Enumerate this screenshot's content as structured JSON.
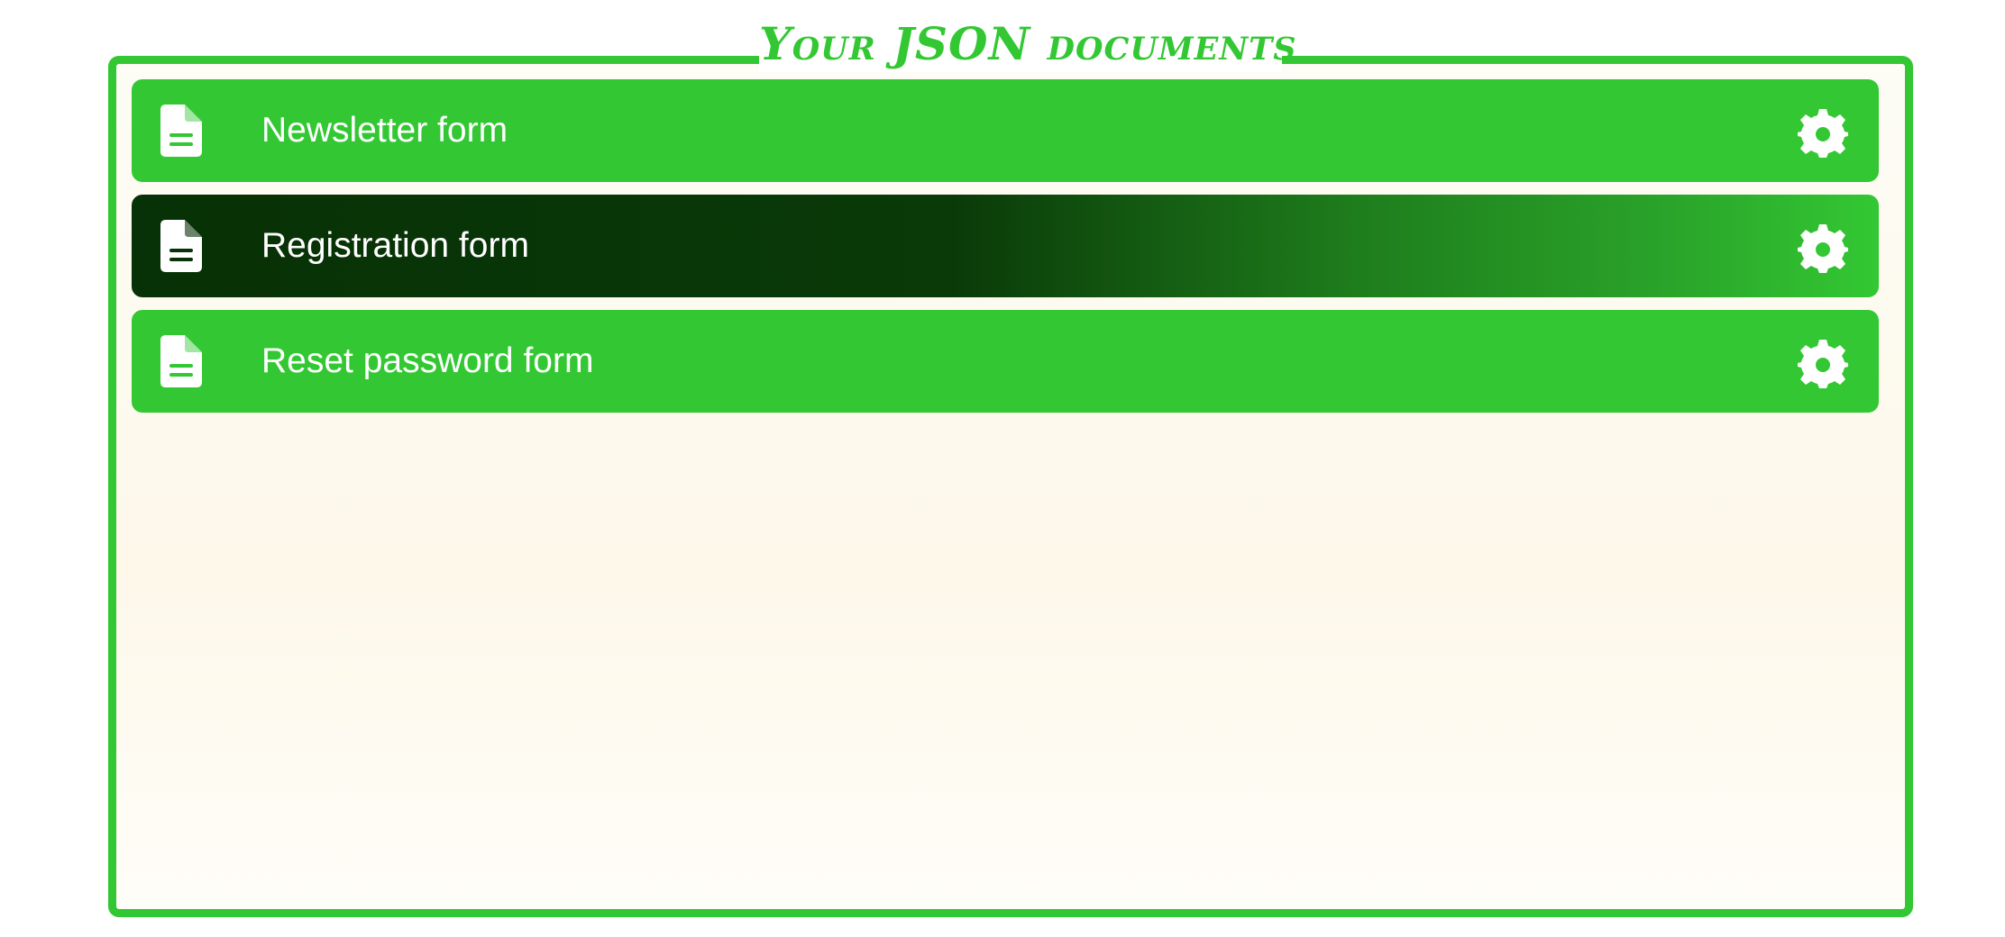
{
  "panel": {
    "title": "Your JSON documents"
  },
  "documents": [
    {
      "label": "Newsletter form",
      "icon": "document-icon",
      "action_icon": "gear-icon",
      "active": false
    },
    {
      "label": "Registration form",
      "icon": "document-icon",
      "action_icon": "gear-icon",
      "active": true
    },
    {
      "label": "Reset password form",
      "icon": "document-icon",
      "action_icon": "gear-icon",
      "active": false
    }
  ],
  "colors": {
    "accent": "#33c833",
    "active_dark": "#073106",
    "text": "#ffffff",
    "panel_bg": "#fdfcf5"
  }
}
